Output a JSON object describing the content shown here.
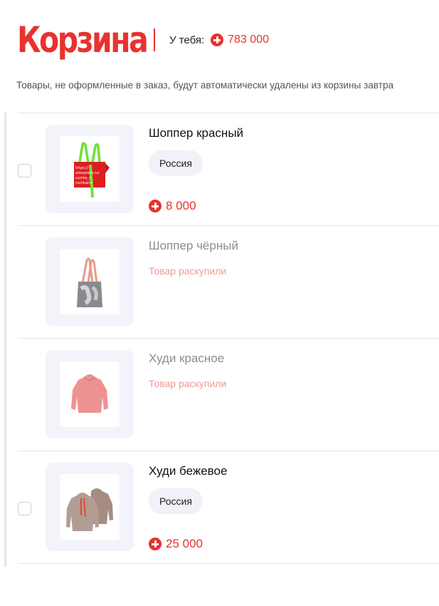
{
  "header": {
    "title": "Корзина",
    "balance_label": "У тебя:",
    "balance_value": "783 000"
  },
  "notice": "Товары, не оформленные в заказ, будут автоматически удалены из корзины завтра",
  "items": [
    {
      "name": "Шоппер красный",
      "badge": "Россия",
      "price": "8 000",
      "status": ""
    },
    {
      "name": "Шоппер чёрный",
      "status": "Товар раскупили"
    },
    {
      "name": "Худи красное",
      "status": "Товар раскупили"
    },
    {
      "name": "Худи бежевое",
      "badge": "Россия",
      "price": "25 000",
      "status": ""
    }
  ],
  "bag_print_text": [
    "https://",
    "aliexpress.ru/",
    "sumka_s_",
    "ruchkami"
  ],
  "colors": {
    "accent": "#e8322f",
    "sold_text": "#f19a93",
    "thumb_bg": "#f3f3fa",
    "badge_bg": "#f1f1f7"
  },
  "icons": [
    "coin-icon",
    "checkbox"
  ]
}
